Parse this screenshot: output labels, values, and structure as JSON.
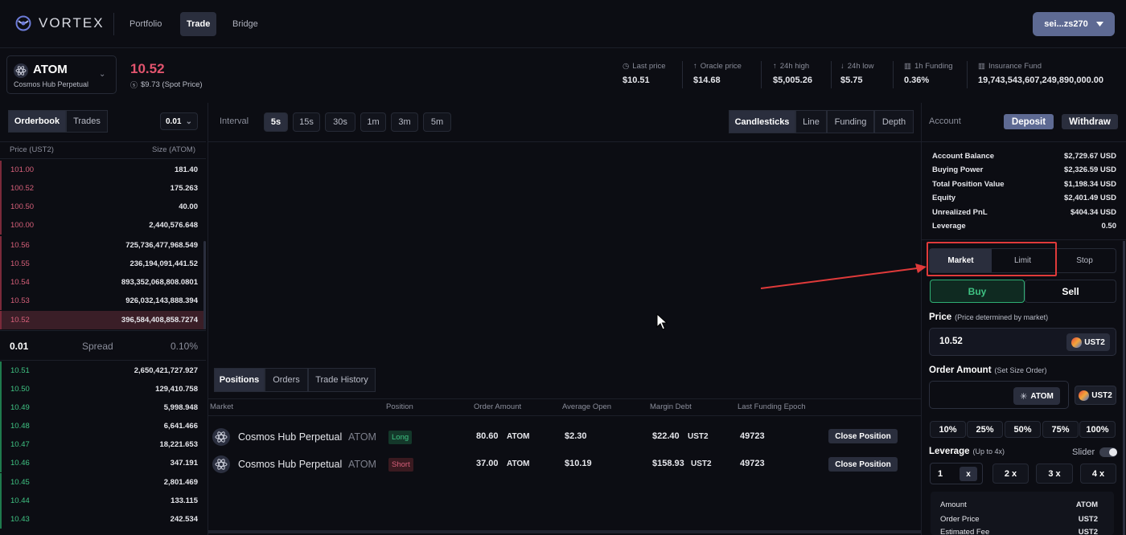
{
  "brand": "VORTEX",
  "nav": [
    {
      "label": "Portfolio",
      "active": false
    },
    {
      "label": "Trade",
      "active": true
    },
    {
      "label": "Bridge",
      "active": false
    }
  ],
  "wallet": {
    "address": "sei...zs270"
  },
  "market": {
    "symbol": "ATOM",
    "name": "Cosmos Hub Perpetual",
    "price": "10.52",
    "spot": "$9.73 (Spot Price)"
  },
  "stats": [
    {
      "label": "Last price",
      "value": "$10.51"
    },
    {
      "label": "Oracle price",
      "value": "$14.68"
    },
    {
      "label": "24h high",
      "value": "$5,005.26"
    },
    {
      "label": "24h low",
      "value": "$5.75"
    },
    {
      "label": "1h Funding",
      "value": "0.36%"
    },
    {
      "label": "Insurance Fund",
      "value": "19,743,543,607,249,890,000.00"
    }
  ],
  "orderbook": {
    "tabs": [
      "Orderbook",
      "Trades"
    ],
    "tick": "0.01",
    "price_header": "Price (UST2)",
    "size_header": "Size (ATOM)",
    "asks": [
      {
        "price": "101.00",
        "size": "181.40"
      },
      {
        "price": "100.52",
        "size": "175.263"
      },
      {
        "price": "100.50",
        "size": "40.00"
      },
      {
        "price": "100.00",
        "size": "2,440,576.648"
      },
      {
        "price": "10.56",
        "size": "725,736,477,968.549"
      },
      {
        "price": "10.55",
        "size": "236,194,091,441.52"
      },
      {
        "price": "10.54",
        "size": "893,352,068,808.0801"
      },
      {
        "price": "10.53",
        "size": "926,032,143,888.394"
      },
      {
        "price": "10.52",
        "size": "396,584,408,858.7274"
      }
    ],
    "spread": {
      "value": "0.01",
      "label": "Spread",
      "pct": "0.10%"
    },
    "bids": [
      {
        "price": "10.51",
        "size": "2,650,421,727.927"
      },
      {
        "price": "10.50",
        "size": "129,410.758"
      },
      {
        "price": "10.49",
        "size": "5,998.948"
      },
      {
        "price": "10.48",
        "size": "6,641.466"
      },
      {
        "price": "10.47",
        "size": "18,221.653"
      },
      {
        "price": "10.46",
        "size": "347.191"
      },
      {
        "price": "10.45",
        "size": "2,801.469"
      },
      {
        "price": "10.44",
        "size": "133.115"
      },
      {
        "price": "10.43",
        "size": "242.534"
      }
    ]
  },
  "chart": {
    "interval_label": "Interval",
    "intervals": [
      "5s",
      "15s",
      "30s",
      "1m",
      "3m",
      "5m"
    ],
    "active_interval": "5s",
    "views": [
      "Candlesticks",
      "Line",
      "Funding",
      "Depth"
    ],
    "active_view": "Candlesticks"
  },
  "positions": {
    "tabs": [
      "Positions",
      "Orders",
      "Trade History"
    ],
    "headers": [
      "Market",
      "Position",
      "Order Amount",
      "Average Open",
      "Margin Debt",
      "Last Funding Epoch"
    ],
    "rows": [
      {
        "market": "Cosmos Hub Perpetual",
        "symbol": "ATOM",
        "side": "Long",
        "amount": "80.60",
        "amount_unit": "ATOM",
        "avg_open": "$2.30",
        "margin": "$22.40",
        "margin_unit": "UST2",
        "epoch": "49723",
        "action": "Close Position"
      },
      {
        "market": "Cosmos Hub Perpetual",
        "symbol": "ATOM",
        "side": "Short",
        "amount": "37.00",
        "amount_unit": "ATOM",
        "avg_open": "$10.19",
        "margin": "$158.93",
        "margin_unit": "UST2",
        "epoch": "49723",
        "action": "Close Position"
      }
    ]
  },
  "account": {
    "title": "Account",
    "deposit": "Deposit",
    "withdraw": "Withdraw",
    "rows": [
      {
        "label": "Account Balance",
        "value": "$2,729.67 USD"
      },
      {
        "label": "Buying Power",
        "value": "$2,326.59 USD"
      },
      {
        "label": "Total Position Value",
        "value": "$1,198.34 USD"
      },
      {
        "label": "Equity",
        "value": "$2,401.49 USD"
      },
      {
        "label": "Unrealized PnL",
        "value": "$404.34 USD"
      },
      {
        "label": "Leverage",
        "value": "0.50"
      }
    ]
  },
  "order": {
    "types": [
      "Market",
      "Limit",
      "Stop"
    ],
    "active_type": "Market",
    "buy": "Buy",
    "sell": "Sell",
    "price_label": "Price",
    "price_hint": "(Price determined by market)",
    "price_value": "10.52",
    "price_unit": "UST2",
    "amount_label": "Order Amount",
    "amount_hint": "(Set Size Order)",
    "amount_unit": "ATOM",
    "alt_unit": "UST2",
    "percents": [
      "10%",
      "25%",
      "50%",
      "75%",
      "100%"
    ],
    "leverage_label": "Leverage",
    "leverage_hint": "(Up to 4x)",
    "slider_label": "Slider",
    "leverage_value": "1",
    "leverage_x": "x",
    "leverage_presets": [
      "2 x",
      "3 x",
      "4 x"
    ],
    "summary": [
      {
        "label": "Amount",
        "value": "ATOM"
      },
      {
        "label": "Order Price",
        "value": "UST2"
      },
      {
        "label": "Estimated Fee",
        "value": "UST2"
      }
    ]
  },
  "colors": {
    "accent": "#5e6a93",
    "ask": "#d7607a",
    "bid": "#3fc383",
    "highlight": "#e03a3a"
  }
}
